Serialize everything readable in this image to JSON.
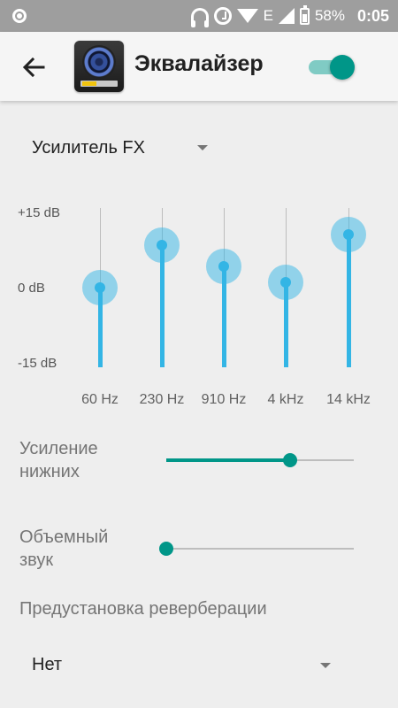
{
  "status_bar": {
    "battery_text": "58%",
    "time": "0:05",
    "network_letter": "E",
    "icons": [
      "notification-icon",
      "headphones-icon",
      "alarm-icon",
      "wifi-icon",
      "signal-icon",
      "battery-icon"
    ]
  },
  "app_bar": {
    "title": "Эквалайзер",
    "enabled": true,
    "icons": [
      "back-arrow-icon",
      "speaker-app-icon"
    ]
  },
  "preset": {
    "selected": "Усилитель FX"
  },
  "equalizer": {
    "db_max": "+15 dB",
    "db_mid": "0 dB",
    "db_min": "-15 dB",
    "range_db": [
      -15,
      15
    ],
    "bands": [
      {
        "label": "60 Hz",
        "gain_db": 0
      },
      {
        "label": "230 Hz",
        "gain_db": 8
      },
      {
        "label": "910 Hz",
        "gain_db": 4
      },
      {
        "label": "4 kHz",
        "gain_db": 1
      },
      {
        "label": "14 kHz",
        "gain_db": 10
      }
    ],
    "colors": {
      "band": "#33b5e5",
      "accent": "#009688"
    }
  },
  "bass_boost": {
    "label_line1": "Усиление",
    "label_line2": "нижних",
    "level": 0.66
  },
  "virtualizer": {
    "label_line1": "Объемный",
    "label_line2": "звук",
    "level": 0.0
  },
  "reverb": {
    "label": "Предустановка реверберации",
    "selected": "Нет"
  }
}
